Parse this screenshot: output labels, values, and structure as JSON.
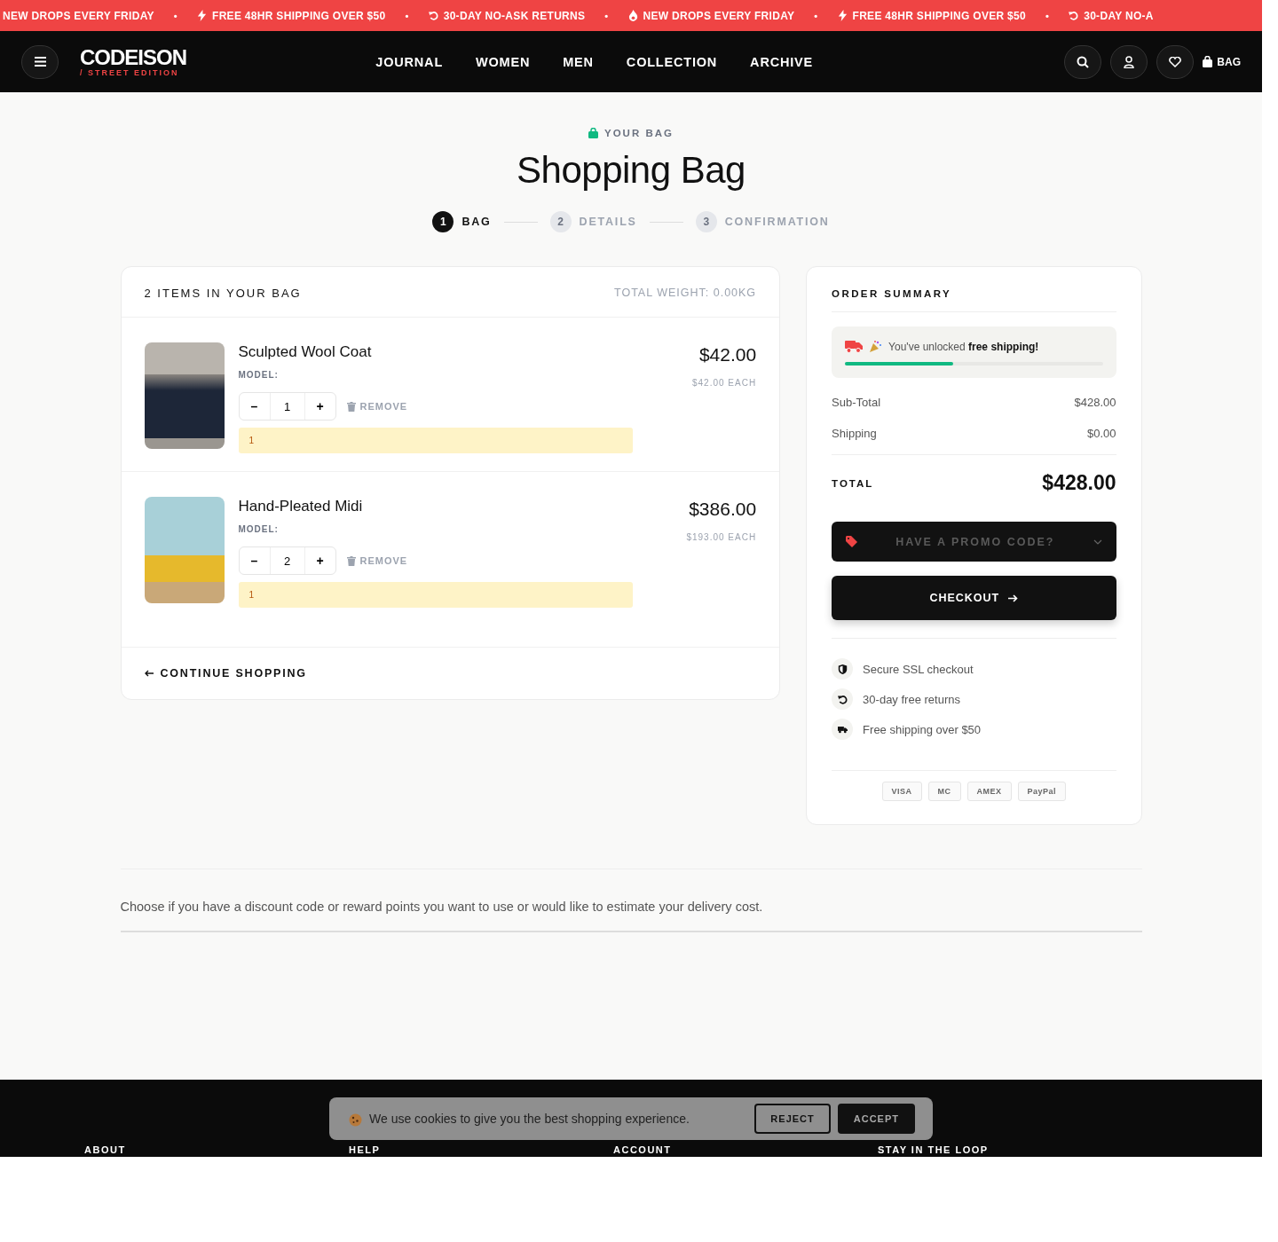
{
  "announcement_bar": {
    "items": [
      {
        "text": "NEW DROPS EVERY FRIDAY"
      },
      {
        "text": "FREE 48HR SHIPPING OVER $50"
      },
      {
        "text": "30-DAY NO-ASK RETURNS"
      },
      {
        "text": "NEW DROPS EVERY FRIDAY"
      },
      {
        "text": "FREE 48HR SHIPPING OVER $50"
      },
      {
        "text": "30-DAY NO-A"
      }
    ],
    "separator": "•"
  },
  "header": {
    "logo": "CODEISON",
    "logo_tagline": "/ STREET EDITION",
    "nav": [
      "JOURNAL",
      "WOMEN",
      "MEN",
      "COLLECTION",
      "ARCHIVE"
    ],
    "bag_label": "BAG"
  },
  "page": {
    "eyebrow": "YOUR BAG",
    "title": "Shopping Bag",
    "steps": [
      {
        "number": "1",
        "label": "BAG",
        "selected": true
      },
      {
        "number": "2",
        "label": "DETAILS",
        "selected": false
      },
      {
        "number": "3",
        "label": "CONFIRMATION",
        "selected": false
      }
    ]
  },
  "cart": {
    "count_label": "2 ITEMS IN YOUR BAG",
    "weight": "TOTAL WEIGHT: 0.00KG",
    "items": [
      {
        "name": "Sculpted Wool Coat",
        "model": "MODEL:",
        "quantity": "1",
        "remove": "REMOVE",
        "notice": "1",
        "price": "$42.00",
        "each": "$42.00 EACH"
      },
      {
        "name": "Hand-Pleated Midi",
        "model": "MODEL:",
        "quantity": "2",
        "remove": "REMOVE",
        "notice": "1",
        "price": "$386.00",
        "each": "$193.00 EACH"
      }
    ],
    "minus": "–",
    "plus": "+",
    "continue": "CONTINUE SHOPPING"
  },
  "summary": {
    "title": "ORDER SUMMARY",
    "shipping_banner": {
      "prefix": "You've unlocked ",
      "bold": "free shipping!",
      "level": 0.42
    },
    "lines": [
      {
        "label": "Sub-Total",
        "value": "$428.00"
      },
      {
        "label": "Shipping",
        "value": "$0.00"
      }
    ],
    "total_label": "TOTAL",
    "total": "$428.00",
    "promo": "HAVE A PROMO CODE?",
    "checkout": "CHECKOUT",
    "perks": [
      {
        "text": "Secure SSL checkout"
      },
      {
        "text": "30-day free returns"
      },
      {
        "text": "Free shipping over $50"
      }
    ],
    "payments": [
      "VISA",
      "MC",
      "AMEX",
      "PayPal"
    ]
  },
  "note": "Choose if you have a discount code or reward points you want to use or would like to estimate your delivery cost.",
  "footer": {
    "headings": [
      "ABOUT",
      "HELP",
      "ACCOUNT",
      "STAY IN THE LOOP"
    ]
  },
  "cookie_banner": {
    "text": "We use cookies to give you the best shopping experience.",
    "reject": "REJECT",
    "accept": "ACCEPT"
  }
}
